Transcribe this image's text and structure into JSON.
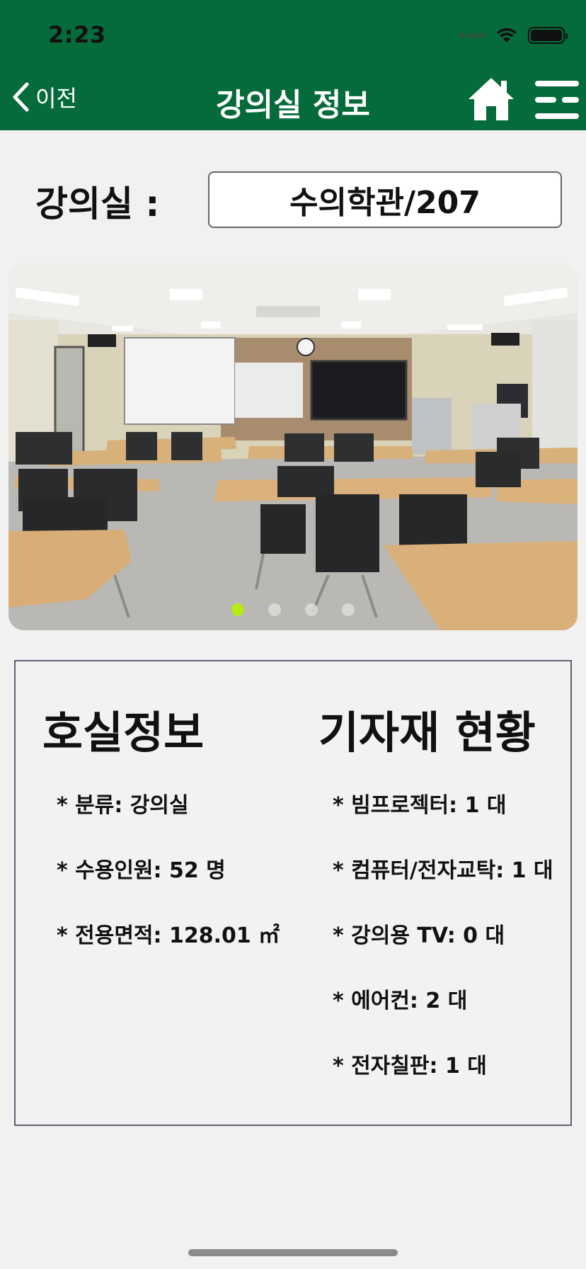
{
  "status_bar": {
    "time": "2:23"
  },
  "header": {
    "back_label": "이전",
    "title": "강의실 정보"
  },
  "room": {
    "label": "강의실 :",
    "value": "수의학관/207"
  },
  "carousel": {
    "page_count": 4,
    "active_index": 0
  },
  "room_info": {
    "heading": "호실정보",
    "items": [
      "* 분류: 강의실",
      "* 수용인원: 52 명",
      "* 전용면적: 128.01 ㎡"
    ]
  },
  "equipment": {
    "heading": "기자재 현황",
    "items": [
      "* 빔프로젝터: 1 대",
      "* 컴퓨터/전자교탁: 1 대",
      "* 강의용 TV: 0 대",
      "* 에어컨: 2 대",
      "* 전자칠판: 1 대"
    ]
  },
  "colors": {
    "header_bg": "#066b3a",
    "page_bg": "#f1f1f1",
    "active_dot": "#b8ea1a"
  },
  "icons": [
    "chevron-left-icon",
    "home-icon",
    "menu-icon",
    "wifi-icon",
    "battery-icon",
    "signal-icon"
  ]
}
